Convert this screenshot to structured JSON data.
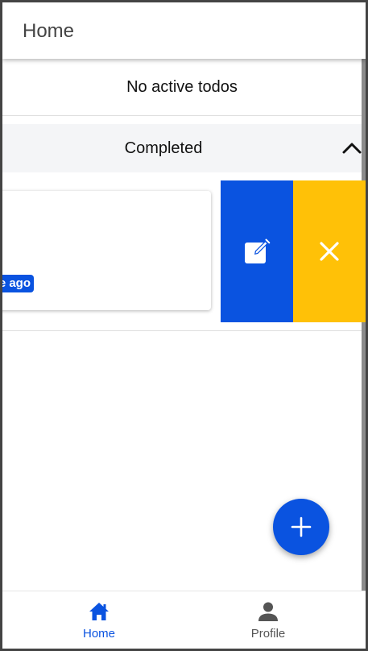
{
  "appbar": {
    "title": "Home"
  },
  "active": {
    "empty_text": "No active todos"
  },
  "completed": {
    "header_label": "Completed",
    "items": [
      {
        "time_text": "e ago"
      }
    ]
  },
  "actions": {
    "edit_icon": "edit-icon",
    "delete_icon": "close-icon"
  },
  "fab": {
    "icon": "plus-icon"
  },
  "bottom_nav": {
    "items": [
      {
        "label": "Home",
        "icon": "home-icon",
        "active": true
      },
      {
        "label": "Profile",
        "icon": "person-icon",
        "active": false
      }
    ]
  },
  "colors": {
    "primary": "#0a53e0",
    "warning": "#ffc107",
    "active_nav": "#0a53e0",
    "inactive_nav": "#555555"
  }
}
